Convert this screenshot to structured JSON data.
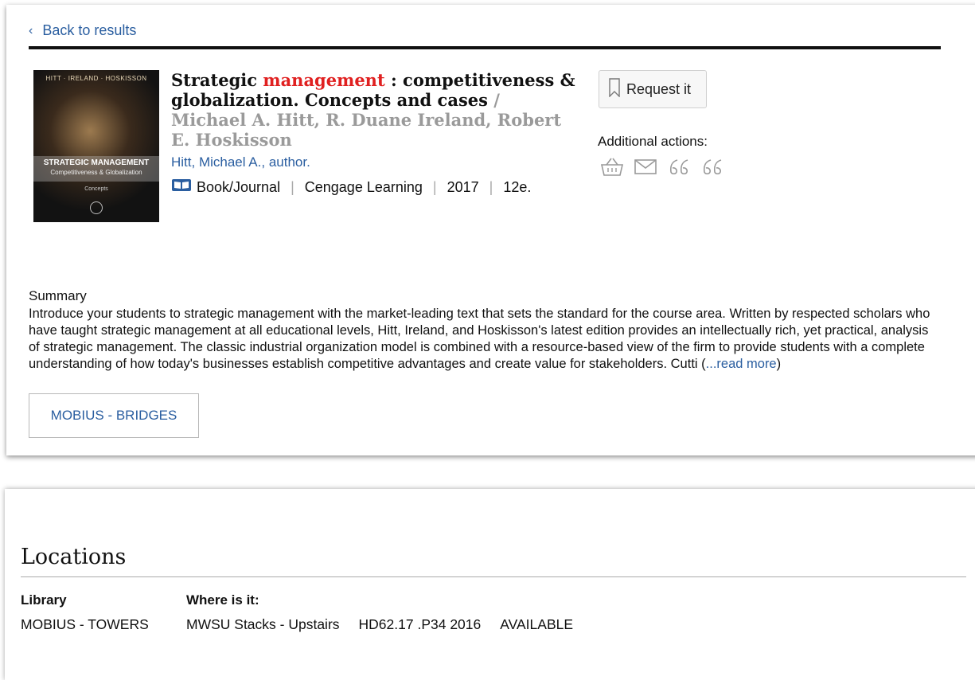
{
  "nav": {
    "back_label": "Back to results"
  },
  "record": {
    "cover": {
      "authors": "HITT · IRELAND · HOSKISSON",
      "title": "STRATEGIC MANAGEMENT",
      "subtitle": "Competitiveness & Globalization",
      "edition": "Concepts"
    },
    "title_pre": "Strategic ",
    "title_highlight": "management",
    "title_post": " : competitiveness & globalization. Concepts and cases",
    "responsibility": " / Michael A. Hitt, R. Duane Ireland, Robert E. Hoskisson",
    "author": "Hitt, Michael A., author.",
    "format": "Book/Journal",
    "format_icon_caption": "Book",
    "publisher": "Cengage Learning",
    "year": "2017",
    "edition": "12e.",
    "separator": "|"
  },
  "actions": {
    "request_label": "Request it",
    "additional_label": "Additional actions:",
    "icons": [
      "basket-icon",
      "email-icon",
      "citation-icon",
      "citation-export-icon"
    ]
  },
  "summary": {
    "heading": "Summary",
    "text": "Introduce your students to strategic management with the market-leading text that sets the standard for the course area. Written by respected scholars who have taught strategic management at all educational levels, Hitt, Ireland, and Hoskisson's latest edition provides an intellectually rich, yet practical, analysis of strategic management. The classic industrial organization model is combined with a resource-based view of the firm to provide students with a complete understanding of how today's businesses establish competitive advantages and create value for stakeholders. Cutti (",
    "more_label": "...read more",
    "close": ")"
  },
  "library_button": "MOBIUS - BRIDGES",
  "locations": {
    "heading": "Locations",
    "headers": {
      "library": "Library",
      "where": "Where is it:"
    },
    "rows": [
      {
        "library": "MOBIUS - TOWERS",
        "location": "MWSU Stacks - Upstairs",
        "call_number": "HD62.17 .P34 2016",
        "status": "AVAILABLE"
      }
    ]
  },
  "colors": {
    "link": "#2a5ea0",
    "highlight": "#e02020",
    "muted": "#9a9a9a"
  }
}
